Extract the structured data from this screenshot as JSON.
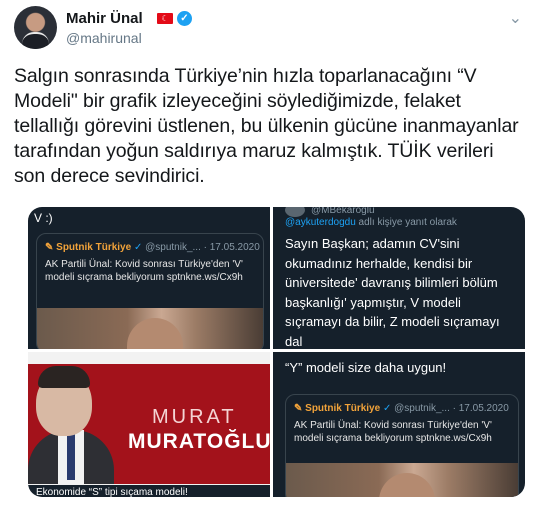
{
  "author": {
    "name": "Mahir Ünal",
    "handle": "@mahirunal",
    "flag_symbol": "☾",
    "verified_symbol": "✓"
  },
  "menu_symbol": "⌄",
  "tweet": {
    "text": "Salgın sonrasında Türkiye’nin hızla toparlanacağını “V Modeli\" bir grafik izleyeceğini söylediğimizde, felaket tellallığı görevini üstlenen, bu ülkenin gücüne inanmayanlar tarafından yoğun saldırıya maruz kalmıştık. TÜİK verileri son derece sevindirici."
  },
  "media": {
    "tile1": {
      "caption": "V :)",
      "embed": {
        "logo": "✎ Sputnik Türkiye",
        "verified": "✓",
        "meta": "@sputnik_... · 17.05.2020",
        "body": "AK Partili Ünal: Kovid sonrası Türkiye'den 'V' modeli sıçrama bekliyorum sptnkne.ws/Cx9h"
      }
    },
    "tile2": {
      "top_name": "@MBekaroglu",
      "mention": "@aykuterdogdu",
      "reply_suffix": " adlı kişiye yanıt olarak",
      "text": "Sayın Başkan; adamın CV'sini okumadınız herhalde, kendisi bir üniversitede' davranış bilimleri bölüm başkanlığı' yapmıştır, V modeli sıçramayı da bilir, Z modeli sıçramayı dal"
    },
    "tile3": {
      "first_name": "MURAT",
      "last_name": "MURATOĞLU",
      "caption": "Ekonomide “S” tipi sıçama modeli!"
    },
    "tile4": {
      "quote": "“Y” modeli size daha uygun!",
      "embed": {
        "logo": "✎ Sputnik Türkiye",
        "verified": "✓",
        "meta": "@sputnik_... · 17.05.2020",
        "body": "AK Partili Ünal: Kovid sonrası Türkiye'den 'V' modeli sıçrama bekliyorum sptnkne.ws/Cx9h"
      }
    }
  }
}
